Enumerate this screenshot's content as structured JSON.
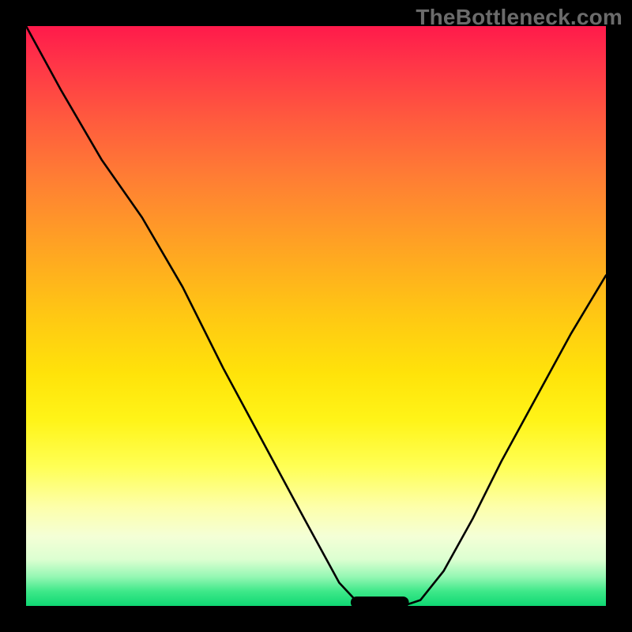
{
  "watermark": "TheBottleneck.com",
  "colors": {
    "marker": "#d96862",
    "curve": "#000000"
  },
  "chart_data": {
    "type": "line",
    "title": "",
    "xlabel": "",
    "ylabel": "",
    "xlim": [
      0,
      100
    ],
    "ylim": [
      0,
      100
    ],
    "grid": false,
    "legend": false,
    "annotations": [],
    "series": [
      {
        "name": "left-branch",
        "x": [
          0,
          6,
          13,
          20,
          27,
          34,
          41,
          48,
          54,
          57,
          59
        ],
        "y": [
          100,
          89,
          77,
          67,
          55,
          41,
          28,
          15,
          4,
          0.8,
          0
        ]
      },
      {
        "name": "right-branch",
        "x": [
          65,
          68,
          72,
          77,
          82,
          88,
          94,
          100
        ],
        "y": [
          0,
          1,
          6,
          15,
          25,
          36,
          47,
          57
        ]
      }
    ],
    "marker": {
      "name": "optimum-marker",
      "x_range": [
        57,
        65
      ],
      "y": 0.6
    }
  }
}
